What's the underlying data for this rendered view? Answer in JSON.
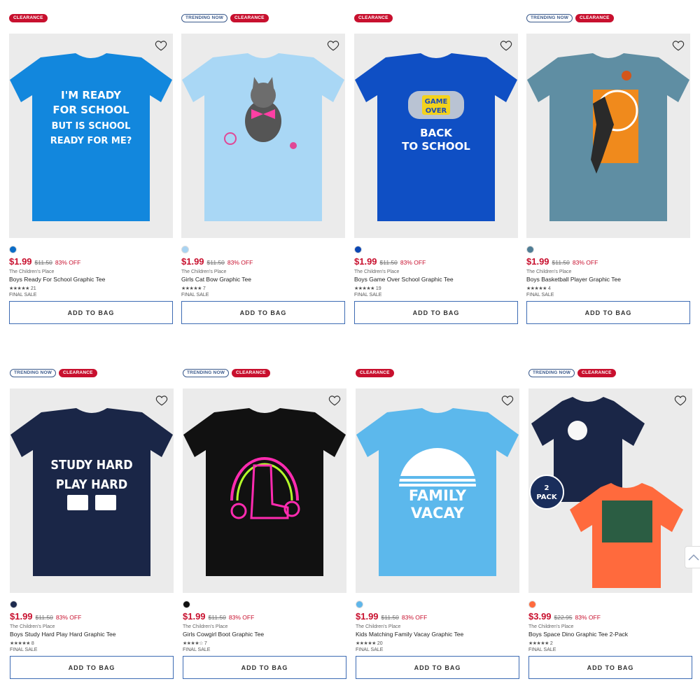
{
  "products": [
    {
      "badges": [
        "CLEARANCE"
      ],
      "price": "$1.99",
      "was": "$11.50",
      "off": "83% OFF",
      "brand": "The Children's Place",
      "name": "Boys Ready For School Graphic Tee",
      "stars": "★★★★★",
      "rating_count": "21",
      "final": "FINAL SALE",
      "cta": "ADD TO BAG",
      "swatch": "#0a6cc7",
      "shirt_color": "#1287dd",
      "graphic": [
        "I'M READY",
        "FOR SCHOOL",
        "BUT IS SCHOOL",
        "READY FOR ME?"
      ]
    },
    {
      "badges": [
        "TRENDING NOW",
        "CLEARANCE"
      ],
      "price": "$1.99",
      "was": "$11.50",
      "off": "83% OFF",
      "brand": "The Children's Place",
      "name": "Girls Cat Bow Graphic Tee",
      "stars": "★★★★★",
      "rating_count": "7",
      "final": "FINAL SALE",
      "cta": "ADD TO BAG",
      "swatch": "#a8d3f2",
      "shirt_color": "#a9d7f5",
      "graphic": []
    },
    {
      "badges": [
        "CLEARANCE"
      ],
      "price": "$1.99",
      "was": "$11.50",
      "off": "83% OFF",
      "brand": "The Children's Place",
      "name": "Boys Game Over School Graphic Tee",
      "stars": "★★★★★",
      "rating_count": "19",
      "final": "FINAL SALE",
      "cta": "ADD TO BAG",
      "swatch": "#0b46b3",
      "shirt_color": "#0f4fc4",
      "graphic": [
        "GAME",
        "OVER",
        "BACK",
        "TO SCHOOL"
      ]
    },
    {
      "badges": [
        "TRENDING NOW",
        "CLEARANCE"
      ],
      "price": "$1.99",
      "was": "$11.50",
      "off": "83% OFF",
      "brand": "The Children's Place",
      "name": "Boys Basketball Player Graphic Tee",
      "stars": "★★★★★",
      "rating_count": "4",
      "final": "FINAL SALE",
      "cta": "ADD TO BAG",
      "swatch": "#4f7d95",
      "shirt_color": "#5f8ea3",
      "graphic": []
    },
    {
      "badges": [
        "TRENDING NOW",
        "CLEARANCE"
      ],
      "price": "$1.99",
      "was": "$11.50",
      "off": "83% OFF",
      "brand": "The Children's Place",
      "name": "Boys Study Hard Play Hard Graphic Tee",
      "stars": "★★★★★",
      "rating_count": "8",
      "final": "FINAL SALE",
      "cta": "ADD TO BAG",
      "swatch": "#1d2a4e",
      "shirt_color": "#1a2647",
      "graphic": [
        "STUDY HARD",
        "PLAY HARD"
      ]
    },
    {
      "badges": [
        "TRENDING NOW",
        "CLEARANCE"
      ],
      "price": "$1.99",
      "was": "$11.50",
      "off": "83% OFF",
      "brand": "The Children's Place",
      "name": "Girls Cowgirl Boot Graphic Tee",
      "stars": "★★★★☆",
      "rating_count": "7",
      "final": "FINAL SALE",
      "cta": "ADD TO BAG",
      "swatch": "#111111",
      "shirt_color": "#111111",
      "graphic": []
    },
    {
      "badges": [
        "CLEARANCE"
      ],
      "price": "$1.99",
      "was": "$11.50",
      "off": "83% OFF",
      "brand": "The Children's Place",
      "name": "Kids Matching Family Vacay Graphic Tee",
      "stars": "★★★★★",
      "rating_count": "20",
      "final": "FINAL SALE",
      "cta": "ADD TO BAG",
      "swatch": "#5fb6ea",
      "shirt_color": "#5cb8ec",
      "graphic": [
        "FAMILY",
        "VACAY"
      ]
    },
    {
      "badges": [
        "TRENDING NOW",
        "CLEARANCE"
      ],
      "price": "$3.99",
      "was": "$22.95",
      "off": "83% OFF",
      "brand": "The Children's Place",
      "name": "Boys Space Dino Graphic Tee 2-Pack",
      "stars": "★★★★★",
      "rating_count": "2",
      "final": "FINAL SALE",
      "cta": "ADD TO BAG",
      "swatch": "#ff6a3d",
      "shirt_color": "#1a2647",
      "graphic": [
        "2",
        "PACK"
      ]
    }
  ]
}
